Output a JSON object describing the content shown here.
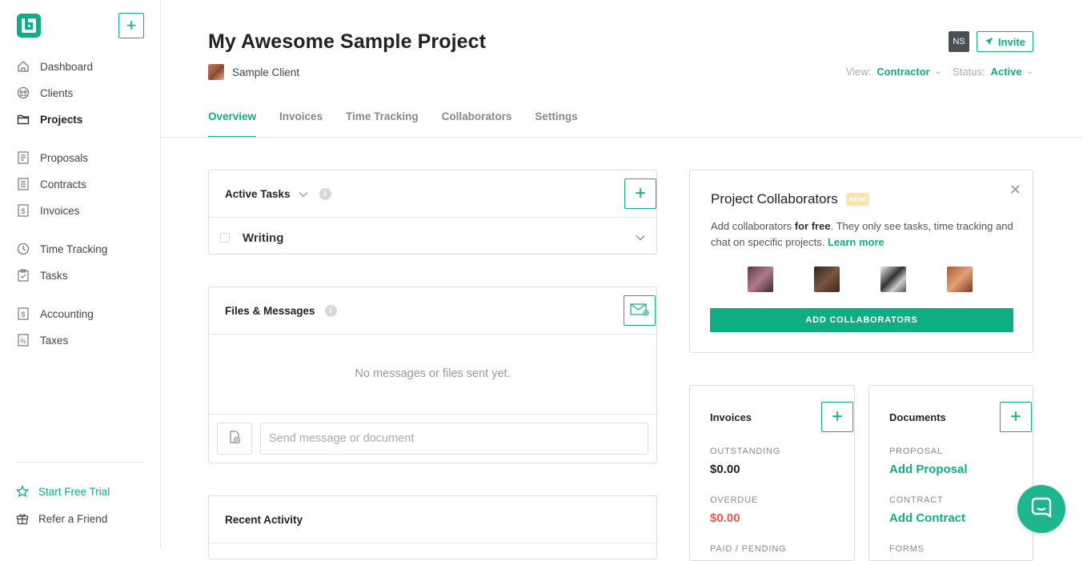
{
  "colors": {
    "accent": "#0fad86",
    "danger": "#f0564a"
  },
  "sidebar": {
    "items": [
      {
        "label": "Dashboard",
        "icon": "home-icon"
      },
      {
        "label": "Clients",
        "icon": "clients-icon"
      },
      {
        "label": "Projects",
        "icon": "folder-icon",
        "active": true
      },
      {
        "label": "Proposals",
        "icon": "proposal-doc-icon"
      },
      {
        "label": "Contracts",
        "icon": "contract-doc-icon"
      },
      {
        "label": "Invoices",
        "icon": "invoice-doc-icon"
      },
      {
        "label": "Time Tracking",
        "icon": "clock-icon"
      },
      {
        "label": "Tasks",
        "icon": "clipboard-icon"
      },
      {
        "label": "Accounting",
        "icon": "accounting-doc-icon"
      },
      {
        "label": "Taxes",
        "icon": "tax-doc-icon"
      }
    ],
    "footer": {
      "trial": "Start Free Trial",
      "refer": "Refer a Friend"
    }
  },
  "header": {
    "title": "My Awesome Sample Project",
    "client": "Sample Client",
    "user_initials": "NS",
    "invite": "Invite",
    "view_label": "View:",
    "view_value": "Contractor",
    "status_label": "Status:",
    "status_value": "Active"
  },
  "tabs": [
    "Overview",
    "Invoices",
    "Time Tracking",
    "Collaborators",
    "Settings"
  ],
  "active_tasks": {
    "title": "Active Tasks",
    "tasks": [
      "Writing"
    ]
  },
  "files_messages": {
    "title": "Files & Messages",
    "empty": "No messages or files sent yet.",
    "placeholder": "Send message or document"
  },
  "recent_activity": {
    "title": "Recent Activity"
  },
  "collaborators": {
    "title": "Project Collaborators",
    "badge": "NEW",
    "desc_pre": "Add collaborators ",
    "desc_bold": "for free",
    "desc_post": ". They only see tasks, time tracking and chat on specific projects. ",
    "learn_more": "Learn more",
    "button": "ADD COLLABORATORS"
  },
  "invoices_card": {
    "title": "Invoices",
    "outstanding_label": "OUTSTANDING",
    "outstanding_value": "$0.00",
    "overdue_label": "OVERDUE",
    "overdue_value": "$0.00",
    "paid_label": "PAID / PENDING"
  },
  "documents_card": {
    "title": "Documents",
    "proposal_label": "PROPOSAL",
    "proposal_action": "Add Proposal",
    "contract_label": "CONTRACT",
    "contract_action": "Add Contract",
    "forms_label": "FORMS"
  }
}
